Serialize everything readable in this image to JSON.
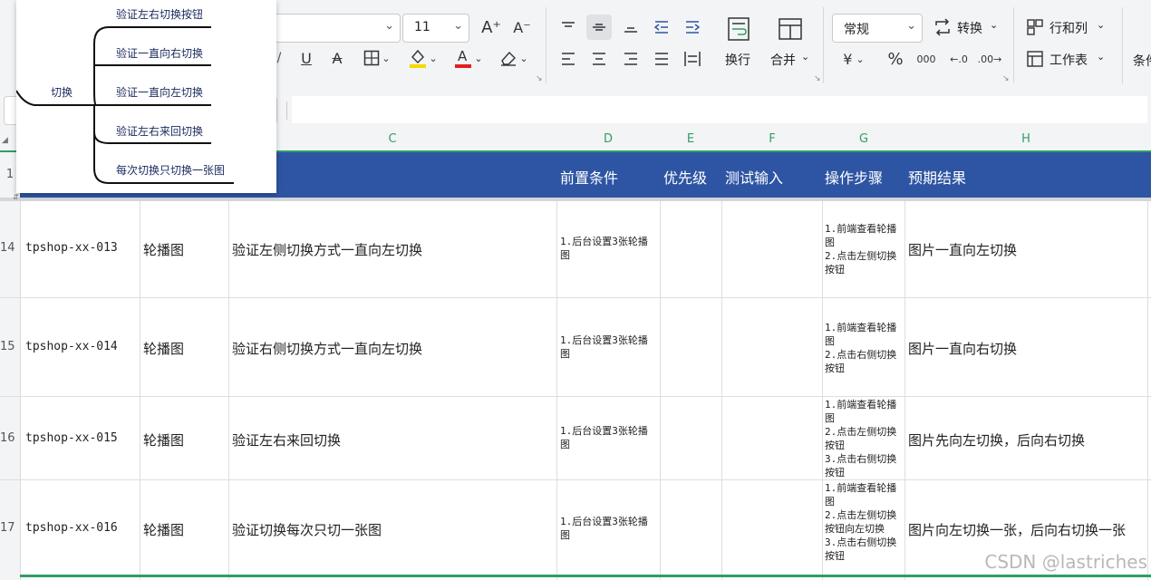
{
  "ribbon": {
    "font_size": "11",
    "font_grow": "A⁺",
    "font_shrink": "A⁻",
    "underline": "U",
    "strike": "A",
    "wrap_label": "换行",
    "merge_label": "合并",
    "number_format": "常规",
    "convert_label": "转换",
    "currency": "¥",
    "percent": "%",
    "thousands": "000",
    "dec_inc": "←.0",
    "dec_dec": ".00→",
    "rows_cols_label": "行和列",
    "worksheet_label": "工作表",
    "cond_label": "条件"
  },
  "columns": [
    "C",
    "D",
    "E",
    "F",
    "G",
    "H"
  ],
  "header_row": {
    "num": "1",
    "precondition": "前置条件",
    "priority": "优先级",
    "test_input": "测试输入",
    "steps": "操作步骤",
    "expected": "预期结果"
  },
  "rows": [
    {
      "num": "14",
      "id": "tpshop-xx-013",
      "module": "轮播图",
      "title": "验证左侧切换方式一直向左切换",
      "pre": "1.后台设置3张轮播图",
      "steps": "1.前端查看轮播图\n2.点击左侧切换按钮",
      "expected": "图片一直向左切换"
    },
    {
      "num": "15",
      "id": "tpshop-xx-014",
      "module": "轮播图",
      "title": "验证右侧切换方式一直向左切换",
      "pre": "1.后台设置3张轮播图",
      "steps": "1.前端查看轮播图\n2.点击右侧切换按钮",
      "expected": "图片一直向右切换"
    },
    {
      "num": "16",
      "id": "tpshop-xx-015",
      "module": "轮播图",
      "title": "验证左右来回切换",
      "pre": "1.后台设置3张轮播图",
      "steps": "1.前端查看轮播图\n2.点击左侧切换按钮\n3.点击右侧切换按钮",
      "expected": "图片先向左切换，后向右切换"
    },
    {
      "num": "17",
      "id": "tpshop-xx-016",
      "module": "轮播图",
      "title": "验证切换每次只切一张图",
      "pre": "1.后台设置3张轮播图",
      "steps": "1.前端查看轮播图\n2.点击左侧切换按钮向左切换\n3.点击右侧切换按钮",
      "expected": "图片向左切换一张，后向右切换一张"
    }
  ],
  "mindmap": {
    "root": "切换",
    "branches": [
      "验证左右切换按钮",
      "验证一直向右切换",
      "验证一直向左切换",
      "验证左右来回切换",
      "每次切换只切换一张图"
    ]
  },
  "watermark": "CSDN @lastriches",
  "colors": {
    "header_bg": "#2e55a3",
    "accent_green": "#2f9e67",
    "font_color_red": "#e02020",
    "highlight_yellow": "#f5d800"
  }
}
